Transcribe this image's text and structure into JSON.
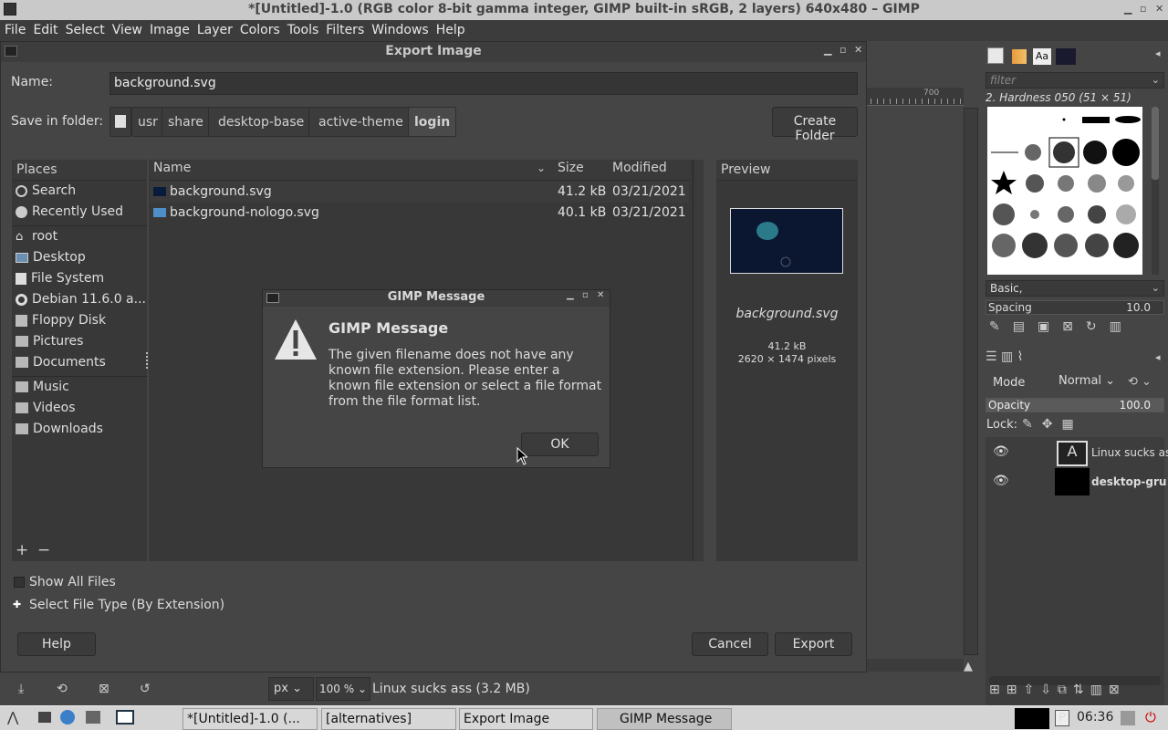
{
  "window": {
    "title": "*[Untitled]-1.0 (RGB color 8-bit gamma integer, GIMP built-in sRGB, 2 layers) 640x480 – GIMP"
  },
  "menubar": [
    "File",
    "Edit",
    "Select",
    "View",
    "Image",
    "Layer",
    "Colors",
    "Tools",
    "Filters",
    "Windows",
    "Help"
  ],
  "export_dialog": {
    "title": "Export Image",
    "name_label": "Name:",
    "name_value": "background.svg",
    "save_in_label": "Save in folder:",
    "path": [
      "usr",
      "share",
      "desktop-base",
      "active-theme",
      "login"
    ],
    "create_folder": "Create Folder",
    "places_header": "Places",
    "places": [
      {
        "label": "Search",
        "icon": "search-icon"
      },
      {
        "label": "Recently Used",
        "icon": "clock-icon"
      },
      {
        "label": "root",
        "icon": "home-icon"
      },
      {
        "label": "Desktop",
        "icon": "desktop-icon"
      },
      {
        "label": "File System",
        "icon": "drive-icon"
      },
      {
        "label": "Debian 11.6.0 a...",
        "icon": "disc-icon"
      },
      {
        "label": "Floppy Disk",
        "icon": "floppy-icon"
      },
      {
        "label": "Pictures",
        "icon": "folder-icon"
      },
      {
        "label": "Documents",
        "icon": "folder-icon"
      },
      {
        "label": "Music",
        "icon": "folder-icon"
      },
      {
        "label": "Videos",
        "icon": "folder-icon"
      },
      {
        "label": "Downloads",
        "icon": "folder-icon"
      }
    ],
    "columns": {
      "name": "Name",
      "size": "Size",
      "modified": "Modified"
    },
    "files": [
      {
        "name": "background.svg",
        "size": "41.2 kB",
        "modified": "03/21/2021"
      },
      {
        "name": "background-nologo.svg",
        "size": "40.1 kB",
        "modified": "03/21/2021"
      }
    ],
    "preview": {
      "header": "Preview",
      "filename": "background.svg",
      "size": "41.2 kB",
      "dimensions": "2620 × 1474 pixels"
    },
    "show_all_files": "Show All Files",
    "select_file_type": "Select File Type (By Extension)",
    "help": "Help",
    "cancel": "Cancel",
    "export": "Export"
  },
  "message_dialog": {
    "title": "GIMP Message",
    "heading": "GIMP Message",
    "body": "The given filename does not have any known file extension. Please enter a known file extension or select a file format from the file format list.",
    "ok": "OK"
  },
  "dock": {
    "brush_filter_placeholder": "filter",
    "brush_name": "2. Hardness 050 (51 × 51)",
    "brush_tag": "Basic,",
    "spacing_label": "Spacing",
    "spacing_value": "10.0",
    "mode_label": "Mode",
    "mode_value": "Normal",
    "opacity_label": "Opacity",
    "opacity_value": "100.0",
    "lock_label": "Lock:",
    "layers": [
      {
        "name": "Linux sucks as"
      },
      {
        "name": "desktop-gru"
      }
    ],
    "ruler_tick": "700"
  },
  "statusbar": {
    "unit": "px",
    "zoom": "100 %",
    "info": "Linux sucks ass (3.2 MB)"
  },
  "taskbar": {
    "tasks": [
      "*[Untitled]-1.0 (...",
      "[alternatives]",
      "Export Image",
      "GIMP Message"
    ],
    "clock": "06:36"
  }
}
